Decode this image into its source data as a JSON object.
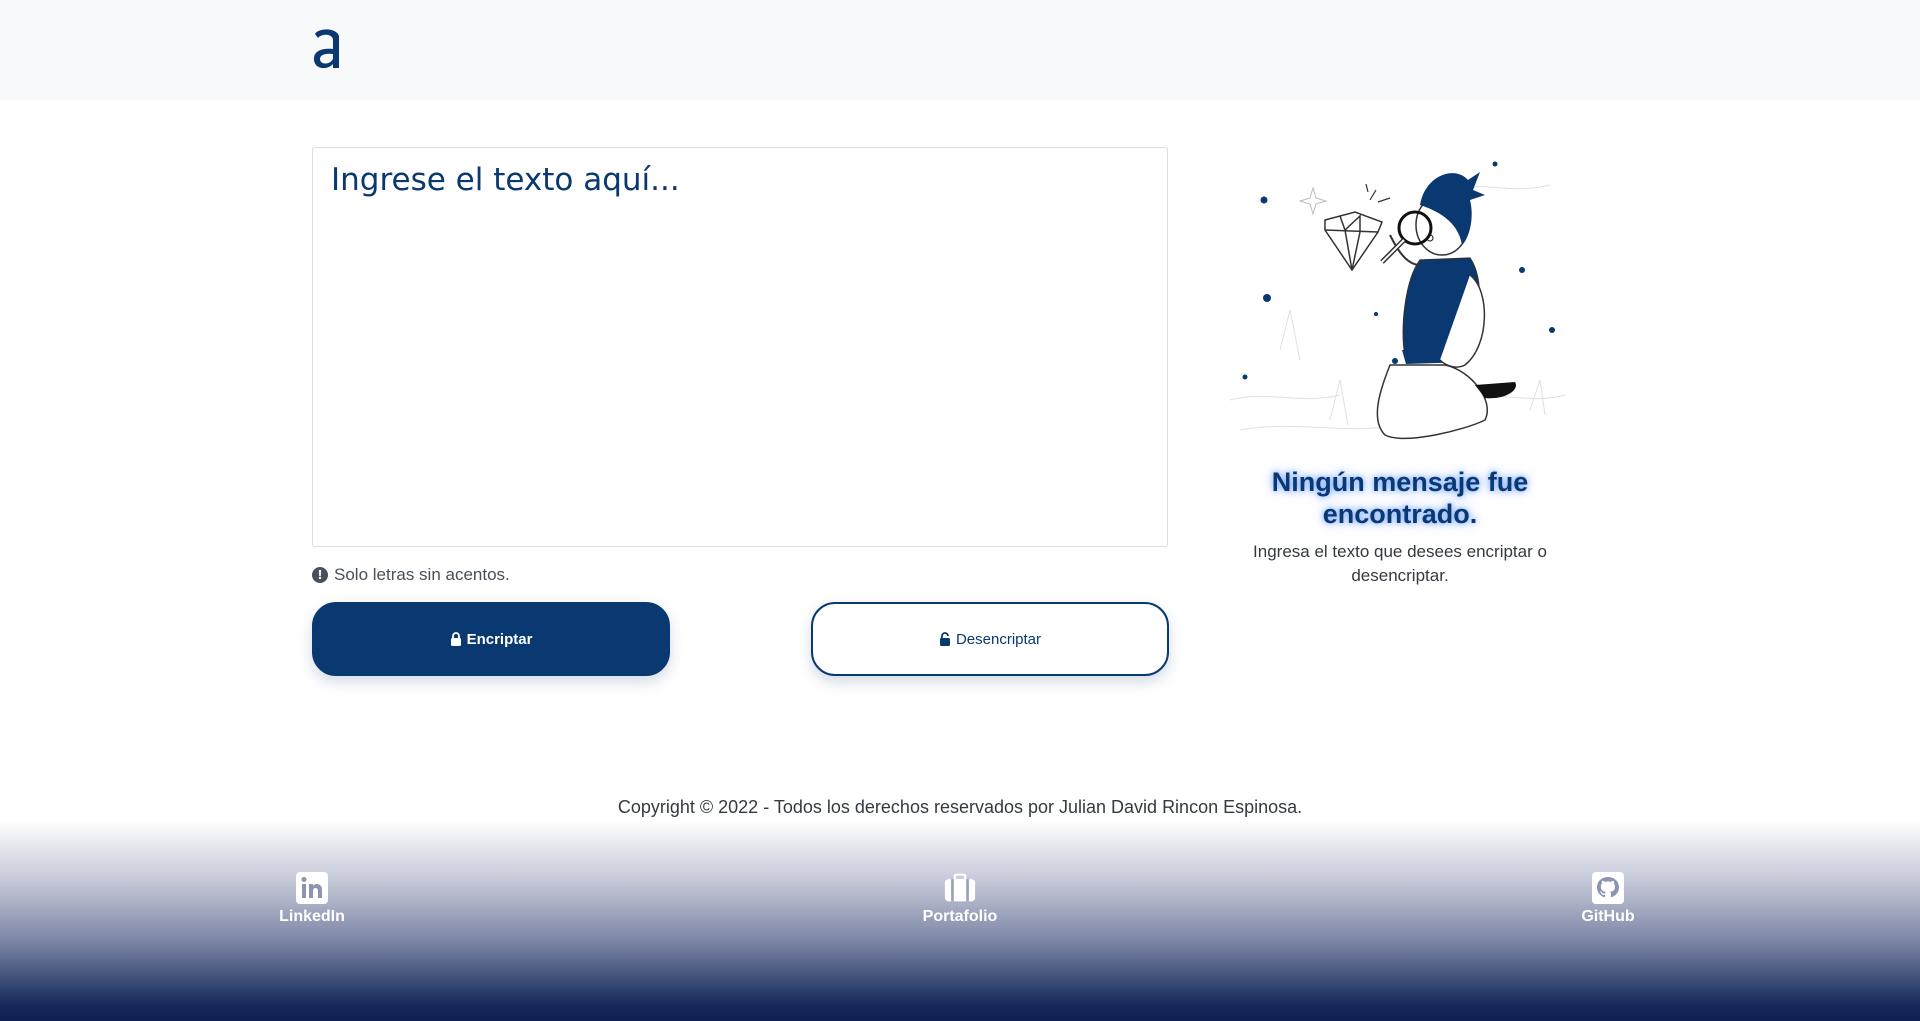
{
  "header": {
    "logo_icon": "alura-logo-icon"
  },
  "input": {
    "placeholder": "Ingrese el texto aquí..."
  },
  "warning": {
    "icon": "exclamation-circle-icon",
    "text": "Solo letras sin acentos."
  },
  "buttons": {
    "encrypt_label": "Encriptar",
    "decrypt_label": "Desencriptar"
  },
  "result_panel": {
    "title": "Ningún mensaje fue encontrado.",
    "subtitle": "Ingresa el texto que desees encriptar o desencriptar."
  },
  "copyright": "Copyright © 2022 - Todos los derechos reservados por Julian David Rincon Espinosa.",
  "footer": {
    "links": [
      {
        "label": "LinkedIn",
        "icon": "linkedin-icon"
      },
      {
        "label": "Portafolio",
        "icon": "briefcase-icon"
      },
      {
        "label": "GitHub",
        "icon": "github-icon"
      }
    ]
  },
  "colors": {
    "primary": "#0a3871",
    "background": "#ffffff",
    "header_bg": "#f8f9fa"
  }
}
